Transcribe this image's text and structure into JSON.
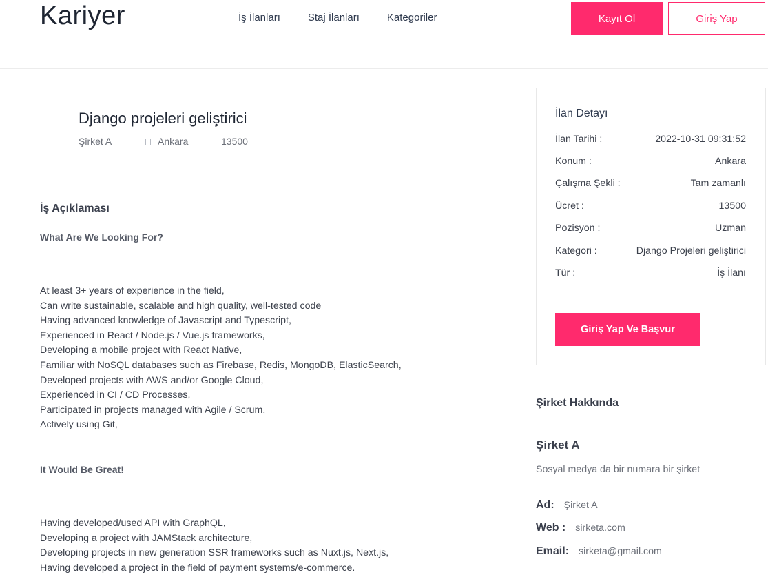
{
  "header": {
    "logo": "Kariyer",
    "nav": [
      "İş İlanları",
      "Staj İlanları",
      "Kategoriler"
    ],
    "register_label": "Kayıt Ol",
    "login_label": "Giriş Yap"
  },
  "job": {
    "title": "Django projeleri geliştirici",
    "company": "Şirket A",
    "location": "Ankara",
    "salary": "13500"
  },
  "description": {
    "section_title": "İş Açıklaması",
    "heading1": "What Are We Looking For?",
    "list1": [
      "At least 3+ years of experience in the field,",
      "Can write sustainable, scalable and high quality, well-tested code",
      "Having advanced knowledge of Javascript and Typescript,",
      "Experienced in React / Node.js / Vue.js frameworks,",
      "Developing a mobile project with React Native,",
      "Familiar with NoSQL databases such as Firebase, Redis, MongoDB, ElasticSearch,",
      "Developed projects with AWS and/or Google Cloud,",
      "Experienced in CI / CD Processes,",
      "Participated in projects managed with Agile / Scrum,",
      "Actively using Git,"
    ],
    "heading2": "It Would Be Great!",
    "list2": [
      "Having developed/used API with GraphQL,",
      "Developing a project with JAMStack architecture,",
      "Developing projects in new generation SSR frameworks such as Nuxt.js, Next.js,",
      "Having developed a project in the field of payment systems/e-commerce."
    ]
  },
  "details": {
    "title": "İlan Detayı",
    "rows": [
      {
        "label": "İlan Tarihi :",
        "value": "2022-10-31 09:31:52"
      },
      {
        "label": "Konum :",
        "value": "Ankara"
      },
      {
        "label": "Çalışma Şekli :",
        "value": "Tam zamanlı"
      },
      {
        "label": "Ücret :",
        "value": "13500"
      },
      {
        "label": "Pozisyon :",
        "value": "Uzman"
      },
      {
        "label": "Kategori :",
        "value": "Django Projeleri geliştirici"
      },
      {
        "label": "Tür :",
        "value": "İş İlanı"
      }
    ],
    "apply_label": "Giriş Yap Ve Başvur"
  },
  "company": {
    "section_title": "Şirket Hakkında",
    "name": "Şirket A",
    "description": "Sosyal medya da bir numara bir şirket",
    "rows": [
      {
        "label": "Ad:",
        "value": "Şirket A"
      },
      {
        "label": "Web :",
        "value": "sirketa.com"
      },
      {
        "label": "Email:",
        "value": "sirketa@gmail.com"
      }
    ]
  },
  "colors": {
    "accent": "#ff2a6d"
  }
}
